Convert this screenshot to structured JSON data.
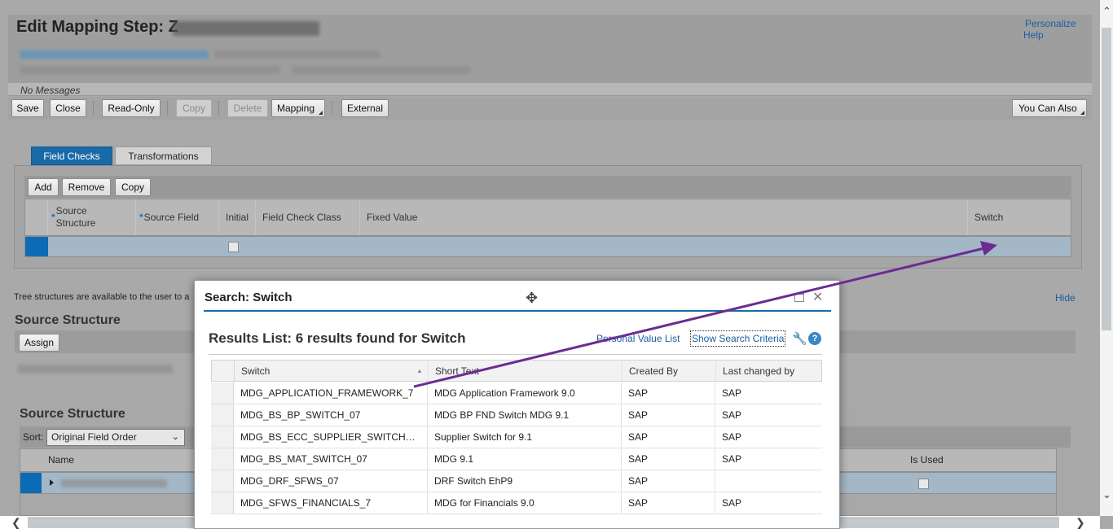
{
  "page": {
    "title": "Edit Mapping Step: Z",
    "personalize": "Personalize",
    "help": "Help",
    "messages": "No Messages"
  },
  "toolbar": {
    "save": "Save",
    "close": "Close",
    "read_only": "Read-Only",
    "copy": "Copy",
    "delete": "Delete",
    "mapping": "Mapping",
    "external": "External",
    "you_can_also": "You Can Also"
  },
  "tabs": [
    {
      "label": "Field Checks",
      "active": true
    },
    {
      "label": "Transformations",
      "active": false
    }
  ],
  "field_checks": {
    "buttons": {
      "add": "Add",
      "remove": "Remove",
      "copy": "Copy"
    },
    "columns": {
      "source_structure": "Source Structure",
      "source_field": "Source Field",
      "initial": "Initial",
      "field_check_class": "Field Check Class",
      "fixed_value": "Fixed Value",
      "switch": "Switch"
    }
  },
  "tree_info": "Tree structures are available to the user to a",
  "hide_link": "Hide",
  "source_structure_upper": {
    "heading": "Source Structure",
    "assign": "Assign"
  },
  "source_structure_lower": {
    "heading": "Source Structure",
    "sort_label": "Sort:",
    "sort_value": "Original Field Order",
    "col_name": "Name",
    "col_is_used": "Is Used"
  },
  "dialog": {
    "title": "Search: Switch",
    "results_heading": "Results List: 6 results found for Switch",
    "personal_value_list": "Personal Value List",
    "show_search_criteria": "Show Search Criteria",
    "columns": {
      "switch": "Switch",
      "short_text": "Short Text",
      "created_by": "Created By",
      "last_changed_by": "Last changed by"
    },
    "rows": [
      {
        "switch": "MDG_APPLICATION_FRAMEWORK_7",
        "short_text": "MDG Application Framework 9.0",
        "created_by": "SAP",
        "last_changed_by": "SAP"
      },
      {
        "switch": "MDG_BS_BP_SWITCH_07",
        "short_text": "MDG BP FND Switch MDG 9.1",
        "created_by": "SAP",
        "last_changed_by": "SAP"
      },
      {
        "switch": "MDG_BS_ECC_SUPPLIER_SWITCH…",
        "short_text": "Supplier Switch for 9.1",
        "created_by": "SAP",
        "last_changed_by": "SAP"
      },
      {
        "switch": "MDG_BS_MAT_SWITCH_07",
        "short_text": "MDG 9.1",
        "created_by": "SAP",
        "last_changed_by": "SAP"
      },
      {
        "switch": "MDG_DRF_SFWS_07",
        "short_text": "DRF Switch EhP9",
        "created_by": "SAP",
        "last_changed_by": ""
      },
      {
        "switch": "MDG_SFWS_FINANCIALS_7",
        "short_text": "MDG for Financials 9.0",
        "created_by": "SAP",
        "last_changed_by": "SAP"
      }
    ]
  },
  "colors": {
    "accent": "#0a6ed1",
    "selected_row": "#cfe3f2",
    "annotation_arrow": "#6a2c91"
  }
}
